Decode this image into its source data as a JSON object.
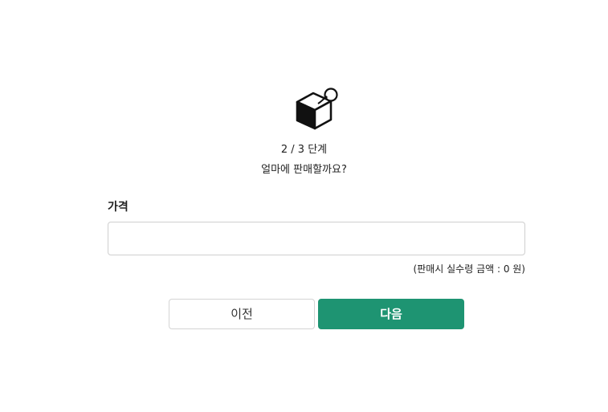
{
  "header": {
    "icon": "price-tag-box-icon",
    "step_text": "2 / 3 단계",
    "question": "얼마에 판매할까요?"
  },
  "form": {
    "price_label": "가격",
    "price_value": "",
    "price_placeholder": "",
    "settlement_note": "(판매시 실수령 금액 : 0 원)"
  },
  "actions": {
    "prev_label": "이전",
    "next_label": "다음"
  },
  "colors": {
    "accent": "#1e9472",
    "text": "#222222",
    "border": "#cfcfcf"
  }
}
